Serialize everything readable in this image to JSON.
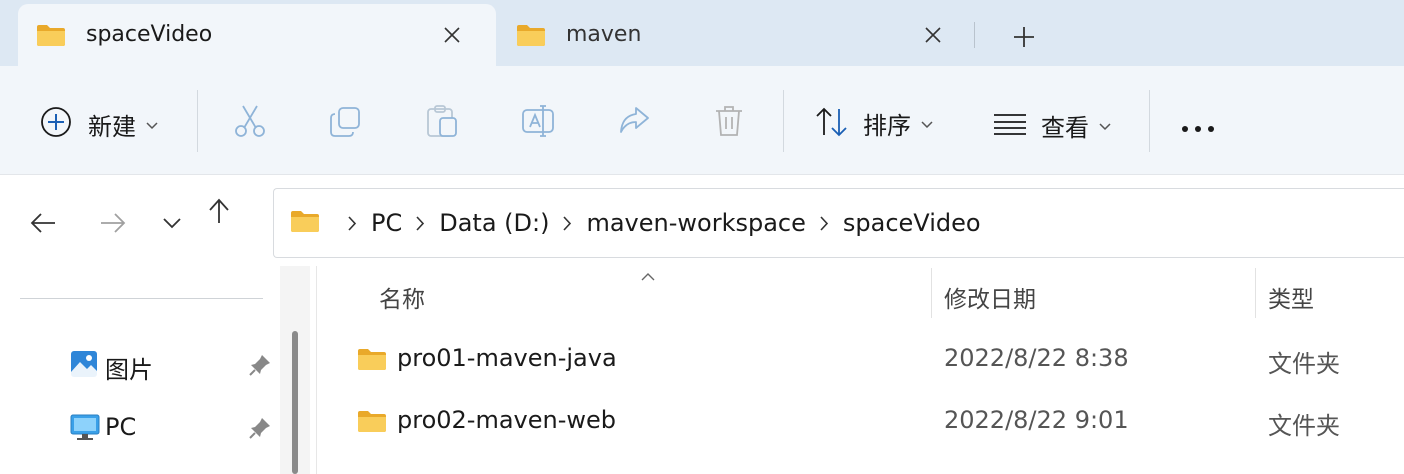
{
  "tabs": [
    {
      "label": "spaceVideo",
      "active": true,
      "icon": "folder-icon"
    },
    {
      "label": "maven",
      "active": false,
      "icon": "folder-icon"
    }
  ],
  "toolbar": {
    "new_label": "新建",
    "sort_label": "排序",
    "view_label": "查看",
    "buttons": [
      "cut-icon",
      "copy-icon",
      "paste-icon",
      "rename-icon",
      "share-icon",
      "delete-icon",
      "more-icon"
    ]
  },
  "breadcrumb": [
    "PC",
    "Data (D:)",
    "maven-workspace",
    "spaceVideo"
  ],
  "nav_pane": {
    "items": [
      {
        "label": "图片",
        "icon": "pictures-icon",
        "pinned": true
      },
      {
        "label": "PC",
        "icon": "pc-icon",
        "pinned": true
      }
    ]
  },
  "file_list": {
    "columns": [
      "名称",
      "修改日期",
      "类型"
    ],
    "rows": [
      {
        "name": "pro01-maven-java",
        "modified": "2022/8/22 8:38",
        "type": "文件夹"
      },
      {
        "name": "pro02-maven-web",
        "modified": "2022/8/22 9:01",
        "type": "文件夹"
      }
    ]
  },
  "colors": {
    "tab_strip": "#dde8f3",
    "command_bar": "#f2f6fa",
    "folder_yellow": "#f7c948",
    "accent_blue": "#1a5fb4"
  }
}
